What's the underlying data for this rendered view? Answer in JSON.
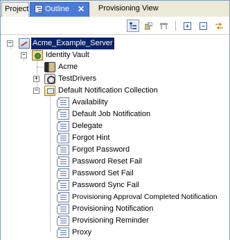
{
  "tabs": [
    {
      "label": "Project",
      "active": false
    },
    {
      "label": "Outline",
      "active": true,
      "close_icon": "close-icon"
    },
    {
      "label": "Provisioning View",
      "active": false
    }
  ],
  "toolbar": {
    "buttons": [
      {
        "name": "hierarchy-view-icon",
        "pressed": true
      },
      {
        "name": "show-attributes-icon",
        "pressed": false
      },
      {
        "name": "filter-icon",
        "pressed": false
      },
      {
        "name": "expand-all-icon",
        "pressed": false
      },
      {
        "name": "collapse-all-icon",
        "pressed": false
      },
      {
        "name": "sync-icon",
        "pressed": false
      }
    ]
  },
  "tree": {
    "server": "Acme_Example_Server",
    "vault": "Identity Vault",
    "acme": "Acme",
    "drivers": "TestDrivers",
    "collection": "Default Notification Collection",
    "templates": [
      "Availability",
      "Default Job Notification",
      "Delegate",
      "Forgot Hint",
      "Forgot Password",
      "Password Reset Fail",
      "Password Set Fail",
      "Password Sync Fail",
      "Provisioning Approval Completed Notification",
      "Provisioning Notification",
      "Provisioning Reminder",
      "Proxy"
    ]
  }
}
